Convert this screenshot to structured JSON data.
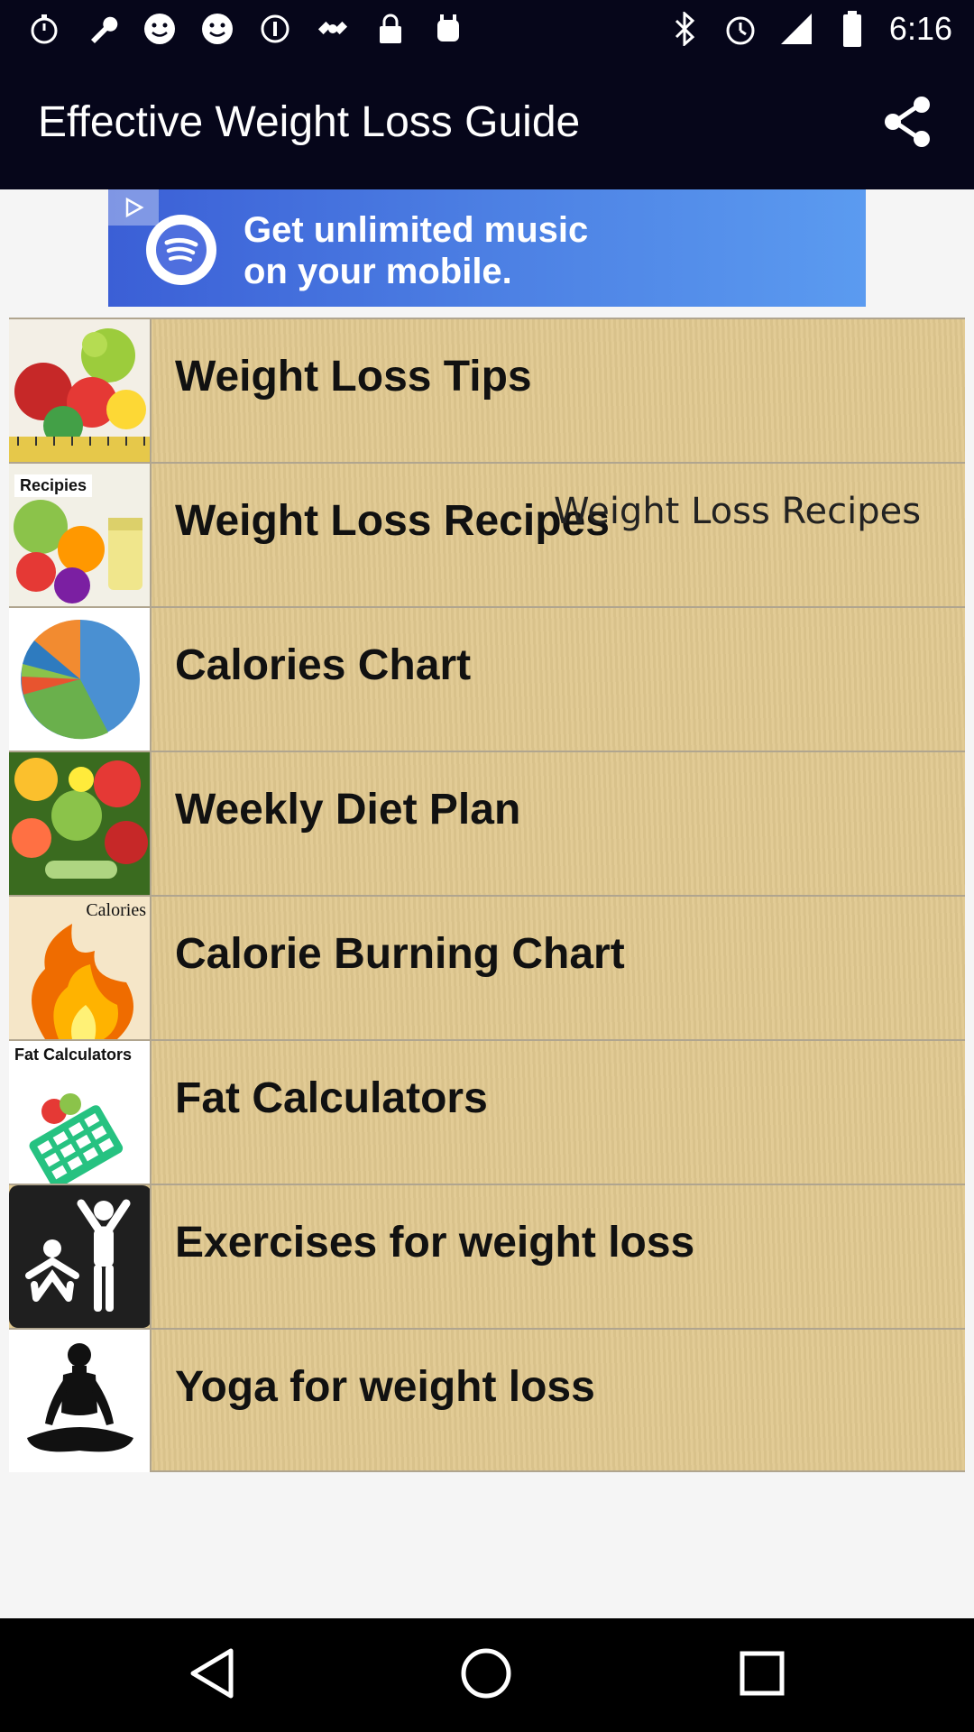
{
  "status_bar": {
    "time": "6:16",
    "left_icons": [
      "stopwatch-icon",
      "wrench-icon",
      "smiley-icon",
      "smiley-icon",
      "info-icon",
      "satellite-icon",
      "lock-icon",
      "android-icon"
    ],
    "right_icons": [
      "bluetooth-icon",
      "alarm-icon",
      "signal-icon",
      "battery-icon"
    ]
  },
  "app_bar": {
    "title": "Effective Weight Loss Guide",
    "share_icon": "share-icon"
  },
  "ad": {
    "text": "Get unlimited music on your mobile.",
    "logo_icon": "spotify-icon",
    "badge_icon": "ad-choices-icon",
    "colors": {
      "start": "#3b5fd6",
      "end": "#5b9bf0"
    }
  },
  "menu": {
    "items": [
      {
        "label": "Weight Loss Tips",
        "thumb": "fruits-icon"
      },
      {
        "label": "Weight Loss Recipes",
        "thumb": "recipes-icon",
        "thumb_caption": "Recipies",
        "overlay": "Weight Loss Recipes"
      },
      {
        "label": "Calories Chart",
        "thumb": "pie-chart-icon"
      },
      {
        "label": "Weekly Diet Plan",
        "thumb": "vegetables-icon"
      },
      {
        "label": "Calorie Burning Chart",
        "thumb": "flame-icon",
        "thumb_caption": "Calories"
      },
      {
        "label": "Fat Calculators",
        "thumb": "calculator-icon",
        "thumb_caption": "Fat Calculators"
      },
      {
        "label": "Exercises for weight loss",
        "thumb": "exercise-icon"
      },
      {
        "label": "Yoga for weight loss",
        "thumb": "yoga-icon"
      }
    ]
  },
  "nav_bar": {
    "back": "back-icon",
    "home": "home-icon",
    "recents": "recents-icon"
  }
}
